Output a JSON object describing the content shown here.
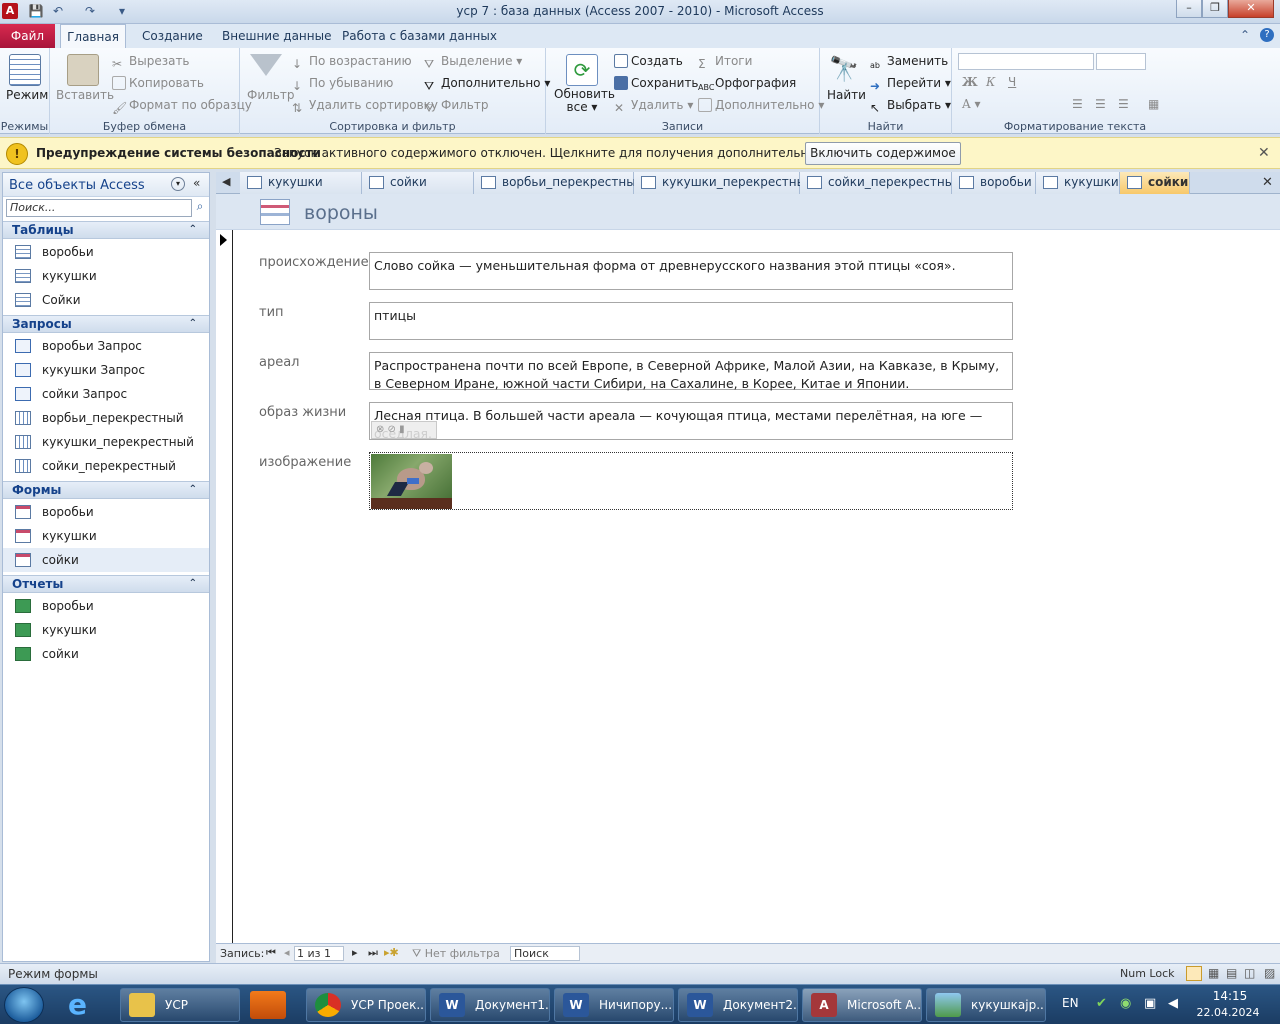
{
  "window": {
    "title": "усp 7 : база данных (Access 2007 - 2010) - Microsoft Access",
    "app_letter": "A"
  },
  "ribbon_tabs": [
    "Файл",
    "Главная",
    "Создание",
    "Внешние данные",
    "Работа с базами данных"
  ],
  "ribbon": {
    "views": {
      "label": "Режим",
      "group": "Режимы"
    },
    "clipboard": {
      "paste": "Вставить",
      "cut": "Вырезать",
      "copy": "Копировать",
      "format": "Формат по образцу",
      "group": "Буфер обмена"
    },
    "sort": {
      "filter": "Фильтр",
      "asc": "По возрастанию",
      "desc": "По убыванию",
      "remove": "Удалить сортировку",
      "selection": "Выделение",
      "advanced": "Дополнительно",
      "toggle": "Фильтр",
      "group": "Сортировка и фильтр"
    },
    "records": {
      "refresh": "Обновить все",
      "create": "Создать",
      "save": "Сохранить",
      "delete": "Удалить",
      "totals": "Итоги",
      "spelling": "Орфография",
      "more": "Дополнительно",
      "group": "Записи"
    },
    "find": {
      "find": "Найти",
      "replace": "Заменить",
      "goto": "Перейти",
      "select": "Выбрать",
      "group": "Найти"
    },
    "text": {
      "bold": "Ж",
      "italic": "К",
      "underline": "Ч",
      "group": "Форматирование текста"
    }
  },
  "security": {
    "title": "Предупреждение системы безопасности",
    "message": "Запуск активного содержимого отключен. Щелкните для получения дополнительных сведений.",
    "button": "Включить содержимое"
  },
  "nav": {
    "title": "Все объекты Access",
    "search_placeholder": "Поиск...",
    "sections": [
      {
        "name": "Таблицы",
        "kind": "tbl",
        "items": [
          "воробьи",
          "кукушки",
          "Сойки"
        ]
      },
      {
        "name": "Запросы",
        "kind": "qry",
        "items": [
          "воробьи Запрос",
          "кукушки Запрос",
          "сойки Запрос",
          "ворбьи_перекрестный",
          "кукушки_перекрестный",
          "сойки_перекрестный"
        ]
      },
      {
        "name": "Формы",
        "kind": "frm",
        "items": [
          "воробьи",
          "кукушки",
          "сойки"
        ]
      },
      {
        "name": "Отчеты",
        "kind": "rpt",
        "items": [
          "воробьи",
          "кукушки",
          "сойки"
        ]
      }
    ]
  },
  "doc_tabs": [
    "кукушки Запрос",
    "сойки Запрос",
    "ворбьи_перекрестный",
    "кукушки_перекрестный",
    "сойки_перекрестный",
    "воробьи",
    "кукушки",
    "сойки"
  ],
  "form": {
    "title": "вороны",
    "fields": [
      {
        "label": "происхождение",
        "value": "Слово сойка — уменьшительная форма от древнерусского названия этой птицы «соя»."
      },
      {
        "label": "тип",
        "value": "птицы"
      },
      {
        "label": "ареал",
        "value": "Распространена почти по всей Европе, в Северной Африке, Малой Азии, на Кавказе, в Крыму, в Северном Иране, южной части Сибири, на Сахалине, в Корее, Китае и Японии."
      },
      {
        "label": "образ жизни",
        "value": "Лесная птица. В большей части ареала — кочующая птица, местами перелётная, на юге — оседлая."
      },
      {
        "label": "изображение",
        "value": ""
      }
    ]
  },
  "recnav": {
    "label": "Запись:",
    "position": "1 из 1",
    "filter": "Нет фильтра",
    "search": "Поиск"
  },
  "status": {
    "mode": "Режим формы",
    "numlock": "Num Lock"
  },
  "taskbar": {
    "items": [
      "УСР",
      "УСР Проек...",
      "Документ1...",
      "Ничипору...",
      "Документ2...",
      "Microsoft A...",
      "кукушкаjp..."
    ],
    "lang": "EN",
    "time": "14:15",
    "date": "22.04.2024"
  }
}
